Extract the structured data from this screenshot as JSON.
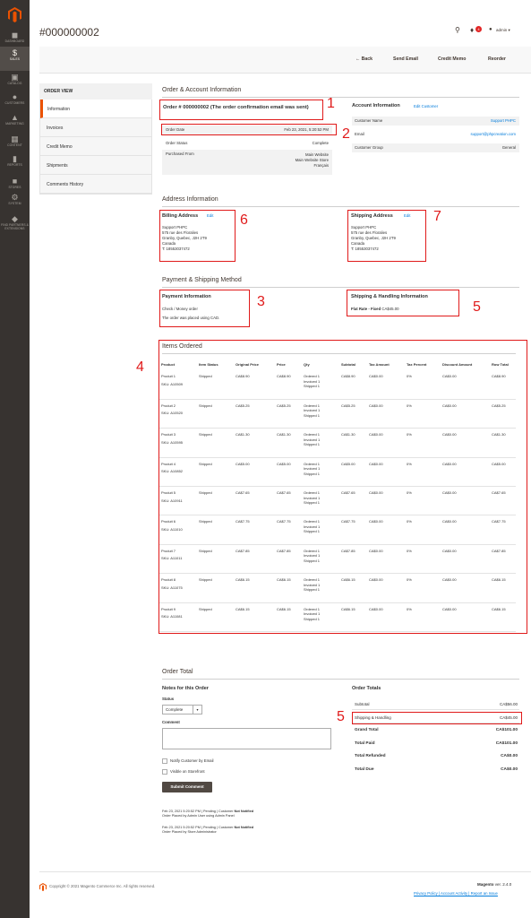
{
  "sidebar": {
    "items": [
      {
        "label": "Dashboard",
        "icon": "dashboard-icon"
      },
      {
        "label": "Sales",
        "icon": "dollar-icon"
      },
      {
        "label": "Catalog",
        "icon": "cube-icon"
      },
      {
        "label": "Customers",
        "icon": "person-icon"
      },
      {
        "label": "Marketing",
        "icon": "megaphone-icon"
      },
      {
        "label": "Content",
        "icon": "layout-icon"
      },
      {
        "label": "Reports",
        "icon": "bar-chart-icon"
      },
      {
        "label": "Stores",
        "icon": "store-icon"
      },
      {
        "label": "System",
        "icon": "gear-icon"
      },
      {
        "label": "Find Partners & Extensions",
        "icon": "puzzle-icon"
      }
    ]
  },
  "header": {
    "title": "#000000002",
    "notification_count": "4",
    "user": "admin ▾"
  },
  "actions": {
    "back": "← Back",
    "send_email": "Send Email",
    "credit_memo": "Credit Memo",
    "reorder": "Reorder"
  },
  "order_view": {
    "heading": "ORDER VIEW",
    "tabs": [
      "Information",
      "Invoices",
      "Credit Memo",
      "Shipments",
      "Comments History"
    ]
  },
  "order_account": {
    "section_title": "Order & Account Information",
    "order_heading": "Order # 000000002 (The order confirmation email was sent)",
    "order_date_label": "Order Date",
    "order_date": "Feb 23, 2021, 5:20:52 PM",
    "order_status_label": "Order Status",
    "order_status": "Complete",
    "purchased_from_label": "Purchased From",
    "purchased_from": [
      "Main Website",
      "Main Website Store",
      "Français"
    ],
    "account_heading": "Account Information",
    "edit_customer": "Edit Customer",
    "customer_name_label": "Customer Name",
    "customer_name": "Support PHPC",
    "email_label": "Email",
    "email": "support@phpcreation.com",
    "group_label": "Customer Group",
    "group": "General"
  },
  "address": {
    "section_title": "Address Information",
    "billing_heading": "Billing Address",
    "shipping_heading": "Shipping Address",
    "edit": "Edit",
    "lines": [
      "Support PHPC",
      "575 rue des Floralies",
      "Granby, Quebec, J2H 2T9",
      "Canada",
      "T: 18553037472"
    ]
  },
  "payment_shipping": {
    "section_title": "Payment & Shipping Method",
    "payment_heading": "Payment Information",
    "payment_method": "Check / Money order",
    "payment_note": "The order was placed using CAD.",
    "shipping_heading": "Shipping & Handling Information",
    "shipping_method": "Flat Rate - Fixed",
    "shipping_amount": "CA$45.00"
  },
  "items": {
    "heading": "Items Ordered",
    "columns": [
      "Product",
      "Item Status",
      "Original Price",
      "Price",
      "Qty",
      "Subtotal",
      "Tax Amount",
      "Tax Percent",
      "Discount Amount",
      "Row Total"
    ],
    "rows": [
      {
        "name": "Produit 1",
        "sku": "SKU: A10509",
        "status": "Shipped",
        "orig": "CA$8.90",
        "price": "CA$8.90",
        "subtotal": "CA$8.90",
        "tax": "CA$0.00",
        "pct": "0%",
        "disc": "CA$0.00",
        "total": "CA$8.90"
      },
      {
        "name": "Produit 2",
        "sku": "SKU: A10520",
        "status": "Shipped",
        "orig": "CA$5.25",
        "price": "CA$5.25",
        "subtotal": "CA$5.25",
        "tax": "CA$0.00",
        "pct": "0%",
        "disc": "CA$0.00",
        "total": "CA$5.25"
      },
      {
        "name": "Produit 3",
        "sku": "SKU: A10595",
        "status": "Shipped",
        "orig": "CA$1.30",
        "price": "CA$1.30",
        "subtotal": "CA$1.30",
        "tax": "CA$0.00",
        "pct": "0%",
        "disc": "CA$0.00",
        "total": "CA$1.30"
      },
      {
        "name": "Produit 4",
        "sku": "SKU: A10852",
        "status": "Shipped",
        "orig": "CA$5.00",
        "price": "CA$5.00",
        "subtotal": "CA$5.00",
        "tax": "CA$0.00",
        "pct": "0%",
        "disc": "CA$0.00",
        "total": "CA$5.00"
      },
      {
        "name": "Produit 5",
        "sku": "SKU: A10911",
        "status": "Shipped",
        "orig": "CA$7.65",
        "price": "CA$7.65",
        "subtotal": "CA$7.65",
        "tax": "CA$0.00",
        "pct": "0%",
        "disc": "CA$0.00",
        "total": "CA$7.65"
      },
      {
        "name": "Produit 6",
        "sku": "SKU: A11010",
        "status": "Shipped",
        "orig": "CA$7.75",
        "price": "CA$7.75",
        "subtotal": "CA$7.75",
        "tax": "CA$0.00",
        "pct": "0%",
        "disc": "CA$0.00",
        "total": "CA$7.75"
      },
      {
        "name": "Produit 7",
        "sku": "SKU: A11011",
        "status": "Shipped",
        "orig": "CA$7.85",
        "price": "CA$7.85",
        "subtotal": "CA$7.85",
        "tax": "CA$0.00",
        "pct": "0%",
        "disc": "CA$0.00",
        "total": "CA$7.85"
      },
      {
        "name": "Produit 8",
        "sku": "SKU: A11075",
        "status": "Shipped",
        "orig": "CA$6.15",
        "price": "CA$6.15",
        "subtotal": "CA$6.15",
        "tax": "CA$0.00",
        "pct": "0%",
        "disc": "CA$0.00",
        "total": "CA$6.15"
      },
      {
        "name": "Produit 9",
        "sku": "SKU: A11081",
        "status": "Shipped",
        "orig": "CA$6.15",
        "price": "CA$6.15",
        "subtotal": "CA$6.15",
        "tax": "CA$0.00",
        "pct": "0%",
        "disc": "CA$0.00",
        "total": "CA$6.15"
      }
    ],
    "qty_lines": [
      "Ordered 1",
      "Invoiced 1",
      "Shipped 1"
    ]
  },
  "order_total": {
    "section_title": "Order Total",
    "notes_heading": "Notes for this Order",
    "status_label": "Status",
    "status_value": "Complete",
    "comment_label": "Comment",
    "notify_label": "Notify Customer by Email",
    "visible_label": "Visible on Storefront",
    "submit": "Submit Comment",
    "history": [
      {
        "line1": "Feb 23, 2021  5:20:52 PM  |  Pending  |  Customer",
        "notified": "Not Notified",
        "line2": "Order Placed by Admin User using Admin Panel"
      },
      {
        "line1": "Feb 23, 2021  5:20:52 PM  |  Pending  |  Customer",
        "notified": "Not Notified",
        "line2": "Order Placed by Store Administrator"
      }
    ],
    "totals_heading": "Order Totals",
    "totals": [
      {
        "label": "Subtotal",
        "value": "CA$56.00"
      },
      {
        "label": "Shipping & Handling",
        "value": "CA$45.00"
      },
      {
        "label": "Grand Total",
        "value": "CA$101.00"
      },
      {
        "label": "Total Paid",
        "value": "CA$101.00"
      },
      {
        "label": "Total Refunded",
        "value": "CA$0.00"
      },
      {
        "label": "Total Due",
        "value": "CA$0.00"
      }
    ]
  },
  "footer": {
    "copyright": "Copyright © 2021 Magento Commerce Inc. All rights reserved.",
    "brand": "Magento",
    "version": "ver. 2.4.0",
    "links": "Privacy Policy | Account Activity | Report an Issue"
  },
  "annotations": [
    "1",
    "2",
    "3",
    "4",
    "5",
    "5",
    "6",
    "7"
  ],
  "colors": {
    "annotation": "#e01a1a",
    "sidebar": "#373330",
    "link": "#007bdb",
    "accent": "#eb5202"
  }
}
